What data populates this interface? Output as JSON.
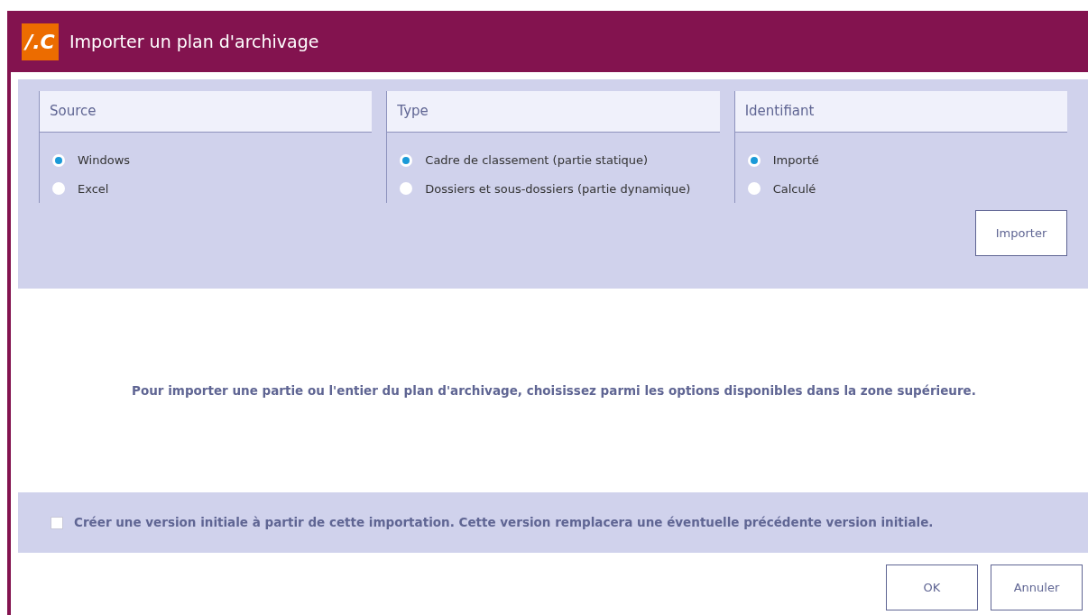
{
  "window": {
    "logo_text": "/.C",
    "title": "Importer un plan d'archivage"
  },
  "groups": [
    {
      "title": "Source",
      "options": [
        {
          "label": "Windows",
          "selected": true
        },
        {
          "label": "Excel",
          "selected": false
        }
      ]
    },
    {
      "title": "Type",
      "options": [
        {
          "label": "Cadre de classement (partie statique)",
          "selected": true
        },
        {
          "label": "Dossiers et sous-dossiers (partie dynamique)",
          "selected": false
        }
      ]
    },
    {
      "title": "Identifiant",
      "options": [
        {
          "label": "Importé",
          "selected": true
        },
        {
          "label": "Calculé",
          "selected": false
        }
      ]
    }
  ],
  "import_button": "Importer",
  "message": "Pour importer une partie ou l'entier du plan d'archivage, choisissez parmi les options disponibles dans la zone supérieure.",
  "initial_version": {
    "label": "Créer une version initiale à partir de cette importation. Cette version remplacera une éventuelle précédente version initiale.",
    "checked": false
  },
  "buttons": [
    "OK",
    "Annuler"
  ]
}
